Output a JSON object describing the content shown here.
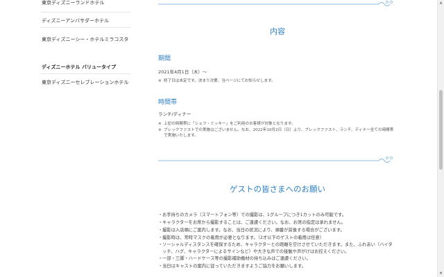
{
  "sidebar": {
    "items_top": [
      "東京ディズニーランドホテル",
      "ディズニーアンバサダーホテル",
      "東京ディズニーシー・ホテルミラコスタ"
    ],
    "heading": "ディズニーホテル バリュータイプ",
    "items_bottom": [
      "東京ディズニーセレブレーションホテル"
    ]
  },
  "content": {
    "title": "内容",
    "period_heading": "期間",
    "period_text": "2021年4月1日（木）～",
    "period_note_mark": "※",
    "period_note": "終了日は未定です。決まり次第、当ページにてお知らせします。",
    "time_heading": "時間帯",
    "time_text": "ランチ/ディナー",
    "time_notes": [
      {
        "mark": "※",
        "text": "上記の時間帯に「シェフ・ミッキー」をご利用のお客様が対象となります。"
      },
      {
        "mark": "※",
        "text": "ブレックファストでの実施はございません。なお、2022年10月2日（日）より、ブレックファスト、ランチ、ディナー全ての時間帯で実施いたします。"
      }
    ]
  },
  "guest": {
    "title": "ゲストの皆さまへのお願い",
    "bullet_mark": "・",
    "items": [
      "お手持ちのカメラ（スマートフォン等）での撮影は、1グループにつき1カットのみ可能です。",
      "キャラクターをお席から撮影することは、ご遠慮ください。なお、お席の指定は承れません。",
      "撮影は入店順にご案内します。なお、当日の状況により、順番が前後する場合がございます。",
      "撮影時は、常時マスクの着用が必要となります。（2才以下のゲストの着用は任意）",
      "ソーシャルディスタンスを確保するため、キャラクターとの距離を空けさせていただきます。また、ふれあい（ハイタッチ、ハグ、キャラクターによるサインなど）や大きな声での接触や声がけはお控えください。",
      "一部・三脚・ハードケース等の撮影補助機材の持ち込みはご遠慮ください。",
      "当日はキャストの案内に従っていただきますようご協力をお願いします。"
    ]
  },
  "colors": {
    "accent": "#2b7fc4",
    "divider": "#6aa8dc"
  },
  "scrollbar": {
    "up_icon": "▲",
    "down_icon": "▼"
  }
}
